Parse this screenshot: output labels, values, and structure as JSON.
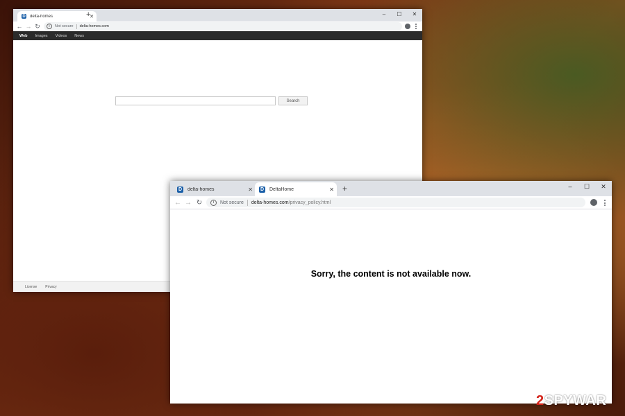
{
  "window1": {
    "tab": {
      "favicon": "D",
      "title": "delta-homes"
    },
    "new_tab": "+",
    "controls": {
      "minimize": "–",
      "maximize": "☐",
      "close": "✕"
    },
    "address": {
      "security": "Not secure",
      "host": "delta-homes.com"
    },
    "nav_links": [
      "Web",
      "Images",
      "Videos",
      "News"
    ],
    "search_button": "Search",
    "search_value": "",
    "footer_links": [
      "License",
      "Privacy"
    ]
  },
  "window2": {
    "tabs": [
      {
        "favicon": "D",
        "title": "delta-homes"
      },
      {
        "favicon": "D",
        "title": "DeltaHome"
      }
    ],
    "new_tab": "+",
    "controls": {
      "minimize": "–",
      "maximize": "☐",
      "close": "✕"
    },
    "address": {
      "security": "Not secure",
      "host": "delta-homes.com",
      "path": "/privacy_policy.html"
    },
    "message": "Sorry, the content is not available now."
  },
  "watermark": {
    "prefix": "2",
    "text": "SPYWAR"
  },
  "icons": {
    "back": "back-arrow-icon",
    "forward": "forward-arrow-icon",
    "reload": "reload-icon",
    "info": "info-icon",
    "account": "account-icon",
    "menu": "menu-dots-icon"
  },
  "colors": {
    "favicon": "#1a5fa8",
    "nav_bar": "#2b2b2b",
    "tabstrip": "#dee1e6"
  }
}
